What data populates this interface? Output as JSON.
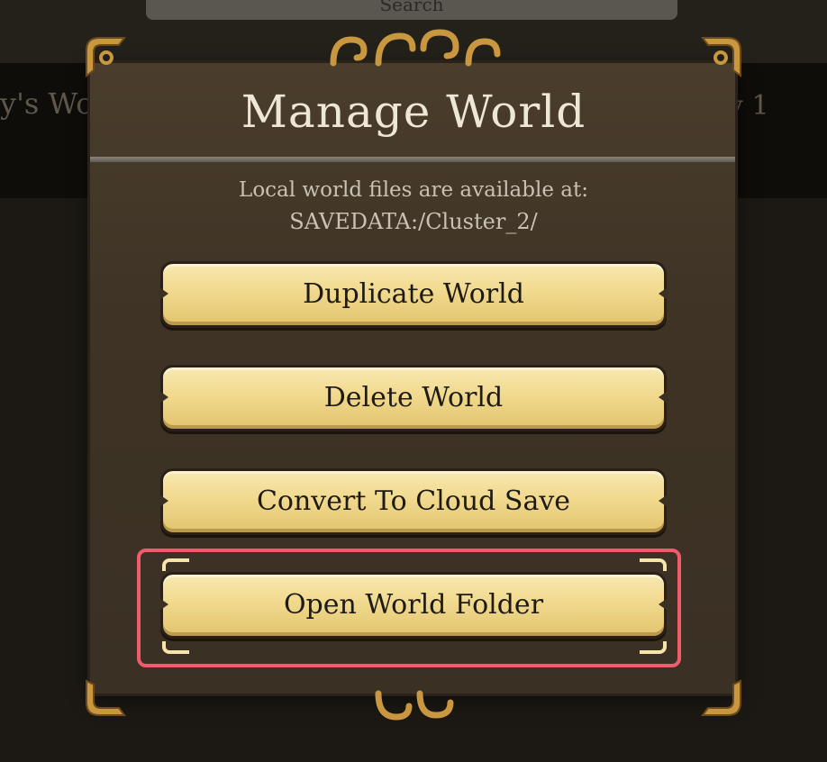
{
  "background": {
    "search_label": "Search",
    "world_left_fragment": "y's Wo",
    "world_right_fragment": "y 1"
  },
  "dialog": {
    "title": "Manage World",
    "info_line1": "Local world files are available at:",
    "info_line2": "SAVEDATA:/Cluster_2/"
  },
  "buttons": [
    {
      "label": "Duplicate World"
    },
    {
      "label": "Delete World"
    },
    {
      "label": "Convert To Cloud Save"
    },
    {
      "label": "Open World Folder"
    }
  ],
  "colors": {
    "panel": "#3e3325",
    "button_gold": "#f1d98e",
    "highlight": "#f05c6c",
    "ornament_gold": "#c9973f"
  },
  "icons": {
    "ornament": "scroll-ornament-icon"
  }
}
